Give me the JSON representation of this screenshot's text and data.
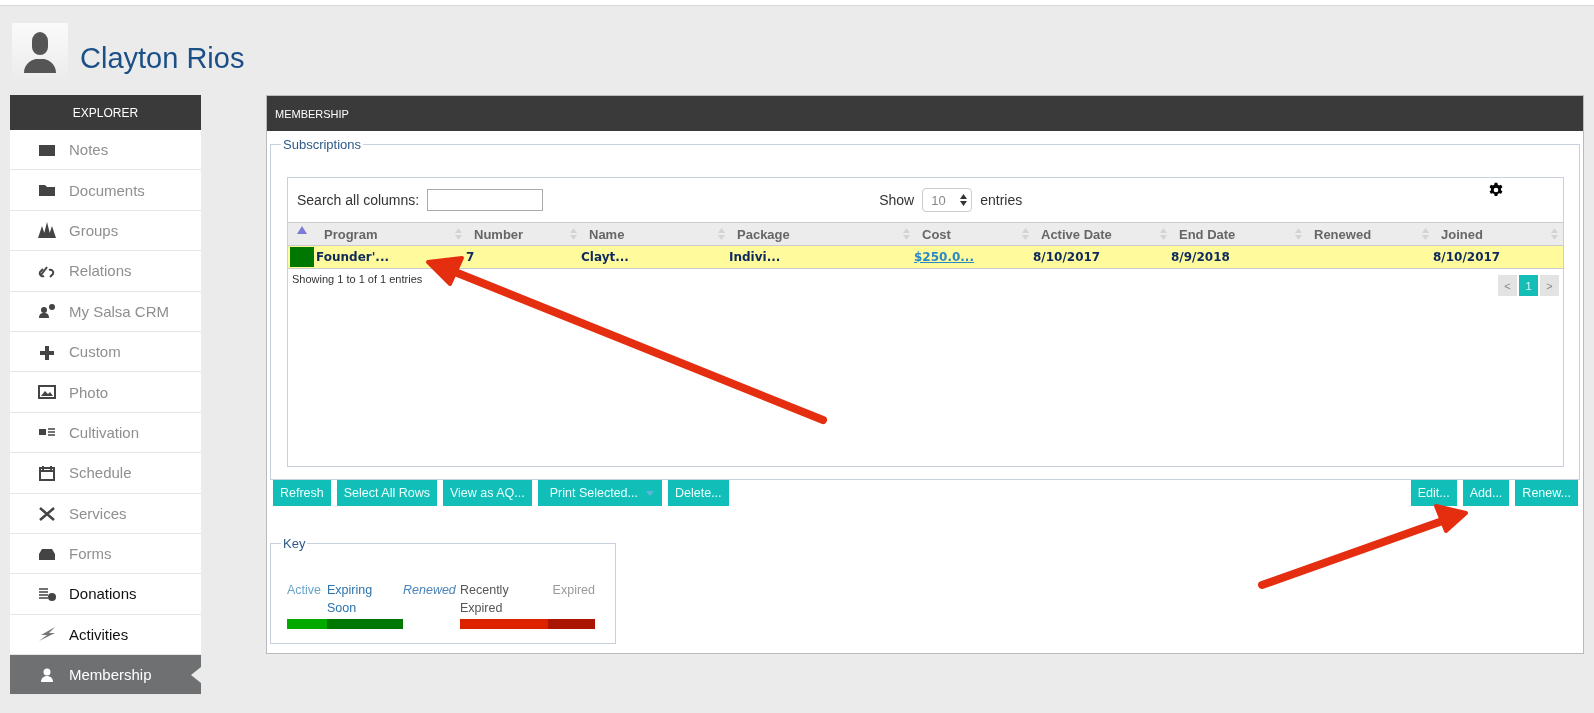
{
  "profile": {
    "name": "Clayton Rios"
  },
  "sidebar": {
    "title": "EXPLORER",
    "items": [
      {
        "label": "Notes",
        "disabled": true,
        "selected": false
      },
      {
        "label": "Documents",
        "disabled": true,
        "selected": false
      },
      {
        "label": "Groups",
        "disabled": true,
        "selected": false
      },
      {
        "label": "Relations",
        "disabled": true,
        "selected": false
      },
      {
        "label": "My Salsa CRM",
        "disabled": true,
        "selected": false
      },
      {
        "label": "Custom",
        "disabled": true,
        "selected": false
      },
      {
        "label": "Photo",
        "disabled": true,
        "selected": false
      },
      {
        "label": "Cultivation",
        "disabled": true,
        "selected": false
      },
      {
        "label": "Schedule",
        "disabled": true,
        "selected": false
      },
      {
        "label": "Services",
        "disabled": true,
        "selected": false
      },
      {
        "label": "Forms",
        "disabled": true,
        "selected": false
      },
      {
        "label": "Donations",
        "disabled": false,
        "selected": false
      },
      {
        "label": "Activities",
        "disabled": false,
        "selected": false
      },
      {
        "label": "Membership",
        "disabled": false,
        "selected": true
      }
    ]
  },
  "panel": {
    "title": "MEMBERSHIP",
    "subscriptions": {
      "legend": "Subscriptions",
      "search_label": "Search all columns:",
      "show_label": "Show",
      "page_size": "10",
      "entries_label": "entries",
      "columns": [
        "Program",
        "Number",
        "Name",
        "Package",
        "Cost",
        "Active Date",
        "End Date",
        "Renewed",
        "Joined"
      ],
      "rows": [
        {
          "color": "#007700",
          "selected": true,
          "cells": [
            "Founder'...",
            "7",
            "Clayt...",
            "Indivi...",
            "$250.0...",
            "8/10/2017",
            "8/9/2018",
            "",
            "8/10/2017"
          ]
        }
      ],
      "info": "Showing 1 to 1 of 1 entries",
      "pages": [
        {
          "label": "<",
          "selected": false
        },
        {
          "label": "1",
          "selected": true
        },
        {
          "label": ">",
          "selected": false
        }
      ]
    },
    "buttons_left": [
      {
        "label": "Refresh",
        "dropdown": false
      },
      {
        "label": "Select All Rows",
        "dropdown": false
      },
      {
        "label": "View as AQ...",
        "dropdown": false
      },
      {
        "label": "Print Selected...",
        "dropdown": true
      },
      {
        "label": "Delete...",
        "dropdown": false
      }
    ],
    "buttons_right": [
      {
        "label": "Edit...",
        "dropdown": false
      },
      {
        "label": "Add...",
        "dropdown": false
      },
      {
        "label": "Renew...",
        "dropdown": false
      }
    ],
    "key": {
      "legend": "Key",
      "items": [
        {
          "label": "Active",
          "kind": "light",
          "color": "#00aa00"
        },
        {
          "label": "Expiring Soon",
          "kind": "blue",
          "color": "#007700"
        },
        {
          "label": "Renewed",
          "kind": "italic"
        },
        {
          "label": "Recently Expired",
          "kind": "dark",
          "color": "#dd2200"
        },
        {
          "label": "Expired",
          "kind": "muted",
          "color": "#aa1500"
        }
      ]
    }
  }
}
